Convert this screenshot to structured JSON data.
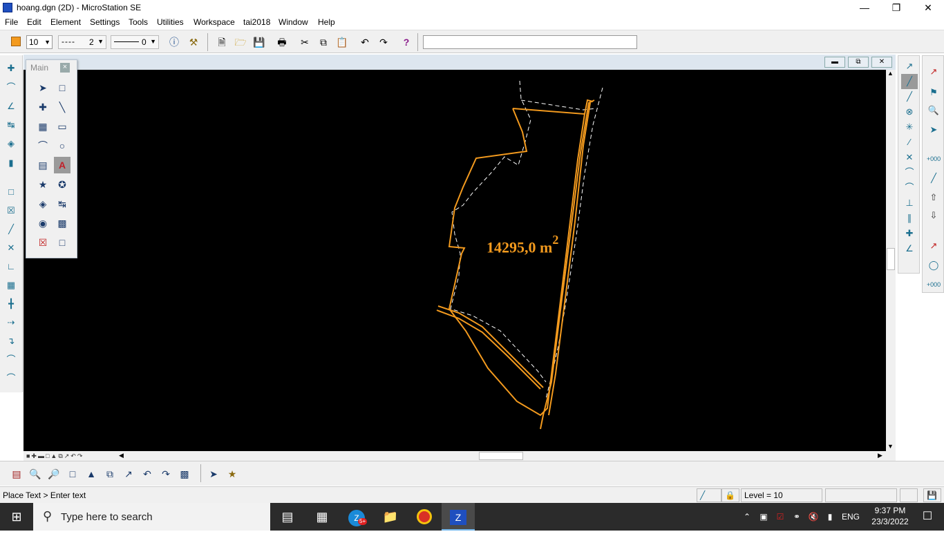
{
  "window": {
    "title": "hoang.dgn (2D) - MicroStation SE",
    "minimize": "—",
    "maximize": "❐",
    "close": "✕"
  },
  "menu": [
    "File",
    "Edit",
    "Element",
    "Settings",
    "Tools",
    "Utilities",
    "Workspace",
    "tai2018",
    "Window",
    "Help"
  ],
  "toolbar": {
    "active_color": "#f39a1e",
    "weight_value": "10",
    "line_style_value": "2",
    "line_weight_value": "0",
    "text_field_value": ""
  },
  "main_palette": {
    "title": "Main",
    "close_label": "×"
  },
  "drawing": {
    "area_label": "14295,0 m",
    "area_superscript": "2",
    "line_color": "#f39a1e",
    "dashed_color": "#ffffff",
    "background": "#000000"
  },
  "status": {
    "prompt": "Place Text > Enter text",
    "level": "Level = 10"
  },
  "taskbar": {
    "search_placeholder": "Type here to search",
    "language": "ENG",
    "time": "9:37 PM",
    "date": "23/3/2022",
    "zalo_badge": "5+"
  }
}
